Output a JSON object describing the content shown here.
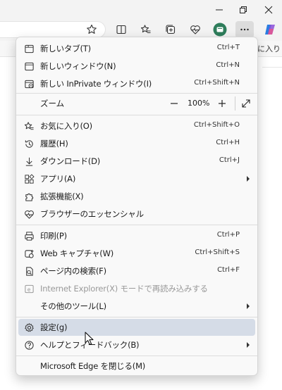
{
  "toolbar": {
    "favorites_bar_text": "に入り"
  },
  "menu": {
    "items_top": [
      {
        "label": "新しいタブ(T)",
        "shortcut": "Ctrl+T"
      },
      {
        "label": "新しいウィンドウ(N)",
        "shortcut": "Ctrl+N"
      },
      {
        "label": "新しい InPrivate ウィンドウ(I)",
        "shortcut": "Ctrl+Shift+N"
      }
    ],
    "zoom": {
      "label": "ズーム",
      "value": "100%"
    },
    "items_mid": [
      {
        "label": "お気に入り(O)",
        "shortcut": "Ctrl+Shift+O"
      },
      {
        "label": "履歴(H)",
        "shortcut": "Ctrl+H"
      },
      {
        "label": "ダウンロード(D)",
        "shortcut": "Ctrl+J"
      },
      {
        "label": "アプリ(A)",
        "shortcut": ""
      },
      {
        "label": "拡張機能(X)",
        "shortcut": ""
      },
      {
        "label": "ブラウザーのエッセンシャル",
        "shortcut": ""
      }
    ],
    "items_tools": [
      {
        "label": "印刷(P)",
        "shortcut": "Ctrl+P"
      },
      {
        "label": "Web キャプチャ(W)",
        "shortcut": "Ctrl+Shift+S"
      },
      {
        "label": "ページ内の検索(F)",
        "shortcut": "Ctrl+F"
      },
      {
        "label": "Internet Explorer(X) モードで再読み込みする",
        "shortcut": ""
      },
      {
        "label": "その他のツール(L)",
        "shortcut": ""
      }
    ],
    "items_settings": [
      {
        "label": "設定(g)",
        "shortcut": ""
      },
      {
        "label": "ヘルプとフィードバック(B)",
        "shortcut": ""
      }
    ],
    "close": {
      "label": "Microsoft Edge を閉じる(M)"
    },
    "hover_color": "#d5dce7"
  },
  "icons": {
    "new_tab": "new-tab-icon",
    "new_window": "new-window-icon",
    "inprivate": "inprivate-icon",
    "favorites": "favorites-icon",
    "history": "history-icon",
    "downloads": "download-icon",
    "apps": "apps-icon",
    "extensions": "extensions-icon",
    "essentials": "heart-pulse-icon",
    "print": "print-icon",
    "web_capture": "web-capture-icon",
    "find": "find-in-page-icon",
    "ie_mode": "ie-mode-icon",
    "settings": "gear-icon",
    "help": "help-icon"
  }
}
